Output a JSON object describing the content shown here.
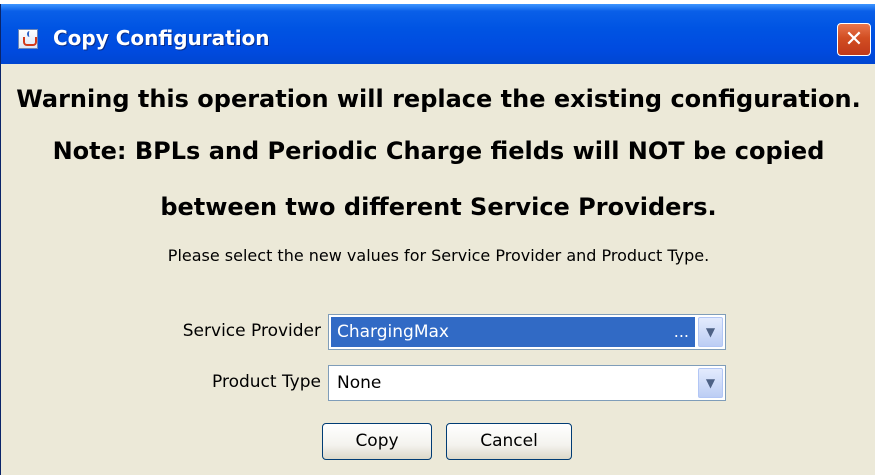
{
  "window": {
    "title": "Copy Configuration",
    "close_label": "✕"
  },
  "messages": {
    "warning": "Warning this operation will replace the existing configuration.",
    "note_line1": "Note: BPLs and Periodic Charge fields will NOT be copied",
    "note_line2": "between two different Service Providers.",
    "instruction": "Please select the new values for Service Provider and Product Type."
  },
  "form": {
    "service_provider": {
      "label": "Service Provider",
      "value": "ChargingMax",
      "ellipsis": "..."
    },
    "product_type": {
      "label": "Product Type",
      "value": "None"
    }
  },
  "buttons": {
    "copy": "Copy",
    "cancel": "Cancel"
  },
  "icons": {
    "app": "java-coffee-cup-icon",
    "close": "close-icon",
    "dropdown": "chevron-down-icon"
  },
  "colors": {
    "titlebar": "#0054e3",
    "close_button": "#d24e22",
    "dialog_background": "#ece9d8",
    "selection": "#316ac5"
  }
}
